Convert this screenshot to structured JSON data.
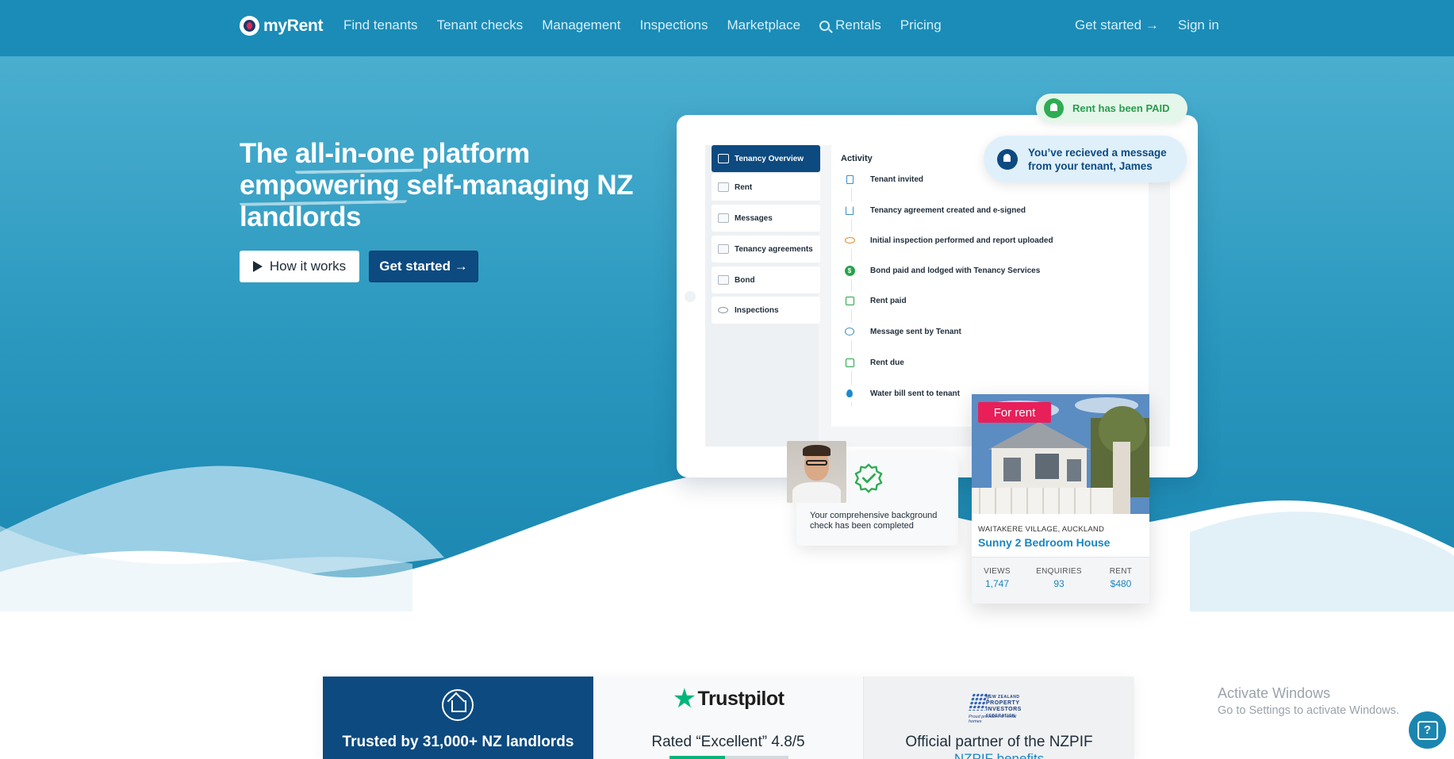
{
  "nav": {
    "brand": "myRent",
    "links": [
      "Find tenants",
      "Tenant checks",
      "Management",
      "Inspections",
      "Marketplace",
      "Rentals",
      "Pricing"
    ],
    "search_icon": "search-icon",
    "get_started": "Get started →",
    "sign_in": "Sign in"
  },
  "hero": {
    "headline_pre": "The ",
    "headline_u1": "all-in-one",
    "headline_mid": " platform ",
    "headline_u2": "empowering",
    "headline_post": " self-managing NZ landlords",
    "how_it_works": "How it works",
    "get_started": "Get started →"
  },
  "dashboard": {
    "sidebar": [
      "Tenancy Overview",
      "Rent",
      "Messages",
      "Tenancy agreements",
      "Bond",
      "Inspections"
    ],
    "activity_title": "Activity",
    "activity": [
      "Tenant invited",
      "Tenancy agreement created and e-signed",
      "Initial inspection performed and report uploaded",
      "Bond paid and lodged with Tenancy Services",
      "Rent paid",
      "Message sent by Tenant",
      "Rent due",
      "Water bill sent to tenant"
    ]
  },
  "notifications": {
    "paid": "Rent has been PAID",
    "message": "You’ve recieved a message from your tenant, James"
  },
  "background_check": {
    "text": "Your comprehensive background check has been completed"
  },
  "listing": {
    "badge": "For rent",
    "location": "WAITAKERE VILLAGE, AUCKLAND",
    "name": "Sunny 2 Bedroom House",
    "stats": [
      {
        "label": "VIEWS",
        "value": "1,747"
      },
      {
        "label": "ENQUIRIES",
        "value": "93"
      },
      {
        "label": "RENT",
        "value": "$480"
      }
    ]
  },
  "trust": {
    "landlords": "Trusted by 31,000+ NZ landlords",
    "trustpilot_brand": "Trustpilot",
    "trustpilot": "Rated “Excellent” 4.8/5",
    "nzpif_logo_lines": [
      "NEW ZEALAND",
      "PROPERTY",
      "INVESTORS",
      "FEDERATION"
    ],
    "nzpif_tagline": "Proud providers of rental homes",
    "nzpif": "Official partner of the NZPIF",
    "nzpif_link": "NZPIF benefits"
  },
  "watermark": {
    "title": "Activate Windows",
    "subtitle": "Go to Settings to activate Windows."
  },
  "colors": {
    "nav_bg": "#1a8cb7",
    "primary": "#0c4a80",
    "accent_pink": "#e91f5a",
    "success": "#2eac54",
    "link": "#1a86c2"
  }
}
